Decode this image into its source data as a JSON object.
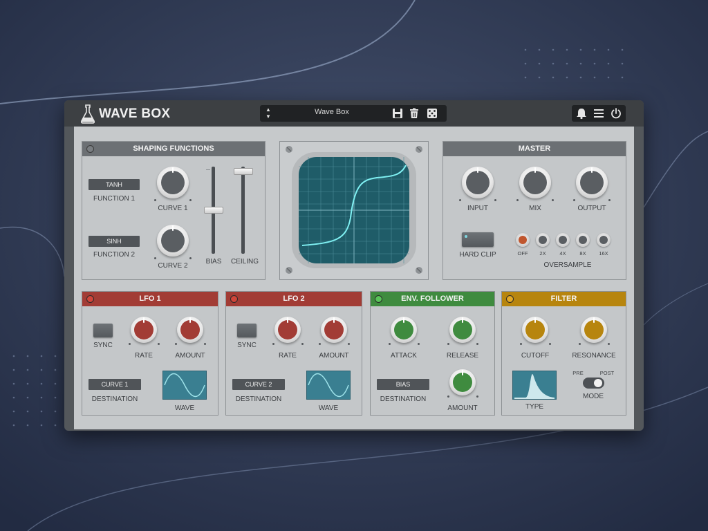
{
  "app": {
    "title": "WAVE BOX",
    "preset_name": "Wave Box",
    "colors": {
      "accent_teal": "#3a7f91",
      "lfo_red": "#a23c35",
      "env_green": "#3f8b3f",
      "filter_orange": "#b7850e"
    },
    "icons": [
      "flask-logo-icon",
      "preset-arrows-icon",
      "save-icon",
      "trash-icon",
      "dice-icon",
      "bell-icon",
      "menu-icon",
      "power-icon"
    ]
  },
  "shaping": {
    "title": "SHAPING FUNCTIONS",
    "function1_value": "TANH",
    "function1_label": "FUNCTION 1",
    "function2_value": "SINH",
    "function2_label": "FUNCTION 2",
    "curve1_label": "CURVE 1",
    "curve2_label": "CURVE 2",
    "bias_label": "BIAS",
    "ceiling_label": "CEILING"
  },
  "master": {
    "title": "MASTER",
    "input_label": "INPUT",
    "mix_label": "MIX",
    "output_label": "OUTPUT",
    "hard_clip_label": "HARD CLIP",
    "oversample_label": "OVERSAMPLE",
    "oversample_options": [
      "OFF",
      "2X",
      "4X",
      "8X",
      "16X"
    ],
    "oversample_selected": "OFF"
  },
  "lfo1": {
    "title": "LFO 1",
    "sync_label": "SYNC",
    "rate_label": "RATE",
    "amount_label": "AMOUNT",
    "destination_value": "CURVE 1",
    "destination_label": "DESTINATION",
    "wave_label": "WAVE"
  },
  "lfo2": {
    "title": "LFO 2",
    "sync_label": "SYNC",
    "rate_label": "RATE",
    "amount_label": "AMOUNT",
    "destination_value": "CURVE 2",
    "destination_label": "DESTINATION",
    "wave_label": "WAVE"
  },
  "env": {
    "title": "ENV. FOLLOWER",
    "attack_label": "ATTACK",
    "release_label": "RELEASE",
    "destination_value": "BIAS",
    "destination_label": "DESTINATION",
    "amount_label": "AMOUNT"
  },
  "filter": {
    "title": "FILTER",
    "cutoff_label": "CUTOFF",
    "resonance_label": "RESONANCE",
    "type_label": "TYPE",
    "pre_label": "PRE",
    "post_label": "POST",
    "mode_label": "MODE",
    "mode_value": "POST"
  }
}
